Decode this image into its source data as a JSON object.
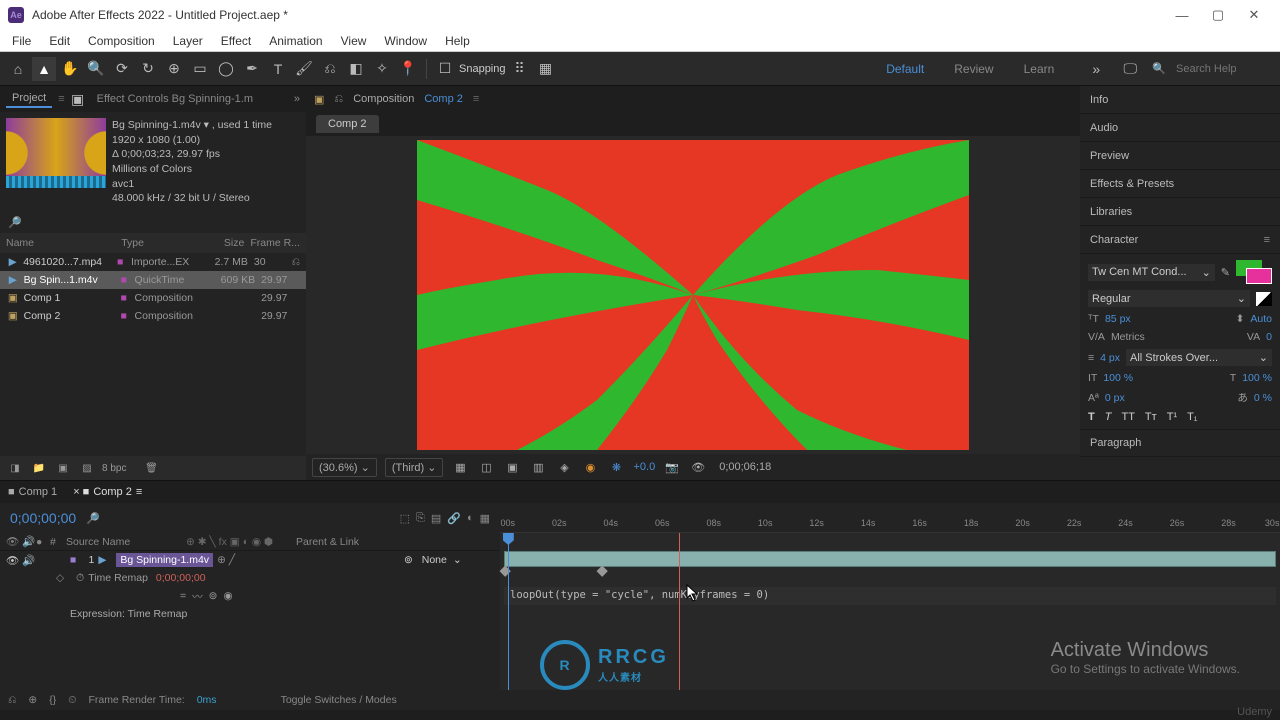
{
  "title_bar": {
    "title": "Adobe After Effects 2022 - Untitled Project.aep *"
  },
  "menu": [
    "File",
    "Edit",
    "Composition",
    "Layer",
    "Effect",
    "Animation",
    "View",
    "Window",
    "Help"
  ],
  "toolbar": {
    "snapping_label": "Snapping",
    "workspaces": [
      "Default",
      "Review",
      "Learn"
    ],
    "search_placeholder": "Search Help"
  },
  "project_panel": {
    "tab1": "Project",
    "tab2": "Effect Controls Bg Spinning-1.m",
    "meta_name": "Bg Spinning-1.m4v ▾ , used 1 time",
    "meta_dim": "1920 x 1080 (1.00)",
    "meta_dur": "Δ 0;00;03;23, 29.97 fps",
    "meta_color": "Millions of Colors",
    "meta_codec": "avc1",
    "meta_audio": "48.000 kHz / 32 bit U / Stereo",
    "cols": {
      "name": "Name",
      "type": "Type",
      "size": "Size",
      "fr": "Frame R..."
    },
    "rows": [
      {
        "name": "4961020...7.mp4",
        "type": "Importe...EX",
        "size": "2.7 MB",
        "fr": "30"
      },
      {
        "name": "Bg Spin...1.m4v",
        "type": "QuickTime",
        "size": "609 KB",
        "fr": "29.97",
        "selected": true
      },
      {
        "name": "Comp 1",
        "type": "Composition",
        "size": "",
        "fr": "29.97"
      },
      {
        "name": "Comp 2",
        "type": "Composition",
        "size": "",
        "fr": "29.97"
      }
    ],
    "bpc": "8 bpc"
  },
  "composition": {
    "breadcrumb_label": "Composition",
    "breadcrumb_active": "Comp 2",
    "subtab": "Comp 2",
    "zoom": "(30.6%)",
    "quality": "(Third)",
    "exposure": "+0.0",
    "timecode": "0;00;06;18"
  },
  "right_panels": [
    "Info",
    "Audio",
    "Preview",
    "Effects & Presets",
    "Libraries"
  ],
  "character": {
    "title": "Character",
    "font": "Tw Cen MT Cond...",
    "style": "Regular",
    "size": "85 px",
    "leading": "Auto",
    "kerning": "Metrics",
    "tracking": "0",
    "stroke": "4 px",
    "stroke_opt": "All Strokes Over...",
    "vscale": "100 %",
    "hscale": "100 %",
    "baseline": "0 px",
    "tsume": "0 %",
    "paragraph_label": "Paragraph"
  },
  "timeline": {
    "tabs": [
      "Comp 1",
      "Comp 2"
    ],
    "current_time": "0;00;00;00",
    "ruler": [
      "00s",
      "02s",
      "04s",
      "06s",
      "08s",
      "10s",
      "12s",
      "14s",
      "16s",
      "18s",
      "20s",
      "22s",
      "24s",
      "26s",
      "28s",
      "30s"
    ],
    "cols": {
      "source": "Source Name",
      "parent": "Parent & Link"
    },
    "layer": {
      "num": "1",
      "name": "Bg Spinning-1.m4v",
      "parent": "None"
    },
    "prop": {
      "name": "Time Remap",
      "value": "0;00;00;00"
    },
    "expr_label": "Expression: Time Remap",
    "expression": "loopOut(type = \"cycle\", numKeyframes = 0)"
  },
  "footer": {
    "frt_label": "Frame Render Time:",
    "frt_val": "0ms",
    "toggle": "Toggle Switches / Modes"
  },
  "activate": {
    "big": "Activate Windows",
    "small": "Go to Settings to activate Windows."
  },
  "watermark": {
    "big": "RRCG",
    "small": "人人素材"
  },
  "udemy": "Udemy"
}
